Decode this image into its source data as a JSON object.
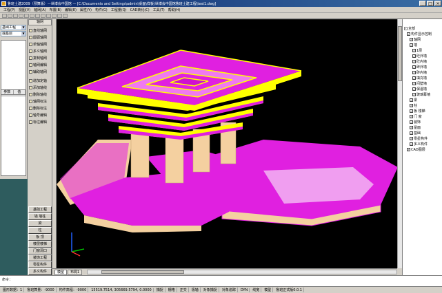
{
  "window": {
    "title": "鲁班土建2009（预算版）—世博会中国馆 — [C:\\Documents and Settings\\admin\\桌面\\样板\\世博会中国馆鲁班土建工程\\test1.dwg]",
    "min": "_",
    "max": "□",
    "close": "×"
  },
  "menu": [
    "工程(P)",
    "视图(V)",
    "轴网(A)",
    "布置(B)",
    "编辑(E)",
    "属性(Y)",
    "构件(G)",
    "工程量(Q)",
    "CAD转化(C)",
    "工具(T)",
    "帮助(H)"
  ],
  "left": {
    "floor_combo": "基础工程",
    "member_combo": "独基层",
    "btn_attr": "属性",
    "btn_change": "更改",
    "grid_cols": [
      "参数",
      "值"
    ]
  },
  "nav": {
    "header": "轴网",
    "items": [
      "直线轴网",
      "圆弧轴网",
      "单轴轴网",
      "多义轴网",
      "复制轴网",
      "轴网编辑",
      "辅助轴网",
      "增加定轴",
      "添加轴线",
      "删除轴线",
      "轴网标注",
      "删除标注",
      "轴号编辑",
      "标注编辑"
    ],
    "categories": [
      "基础工程",
      "墙 墙柱",
      "梁",
      "柱",
      "板 顶",
      "楼层楼梯",
      "门窗洞口",
      "装饰工程",
      "零星构件",
      "多义构件"
    ]
  },
  "tabs": [
    "模型",
    "布局1"
  ],
  "tree": {
    "root": "全部",
    "nodes": [
      {
        "label": "构件显示控制",
        "checked": true,
        "depth": 1
      },
      {
        "label": "轴网",
        "checked": true,
        "depth": 2
      },
      {
        "label": "墙",
        "checked": true,
        "depth": 2
      },
      {
        "label": "1层",
        "checked": true,
        "depth": 3
      },
      {
        "label": "砼外墙",
        "checked": true,
        "depth": 3
      },
      {
        "label": "砼内墙",
        "checked": true,
        "depth": 3
      },
      {
        "label": "砖外墙",
        "checked": true,
        "depth": 3
      },
      {
        "label": "砖内墙",
        "checked": true,
        "depth": 3
      },
      {
        "label": "填充墙",
        "checked": true,
        "depth": 3
      },
      {
        "label": "间壁墙",
        "checked": true,
        "depth": 3
      },
      {
        "label": "保温墙",
        "checked": true,
        "depth": 3
      },
      {
        "label": "玻璃幕墙",
        "checked": true,
        "depth": 3
      },
      {
        "label": "梁",
        "checked": true,
        "depth": 2
      },
      {
        "label": "柱",
        "checked": true,
        "depth": 2
      },
      {
        "label": "板 楼梯",
        "checked": true,
        "depth": 2
      },
      {
        "label": "门 窗",
        "checked": true,
        "depth": 2
      },
      {
        "label": "装饰",
        "checked": true,
        "depth": 2
      },
      {
        "label": "屋面",
        "checked": true,
        "depth": 2
      },
      {
        "label": "基础",
        "checked": true,
        "depth": 2
      },
      {
        "label": "零星构件",
        "checked": true,
        "depth": 2
      },
      {
        "label": "多义构件",
        "checked": true,
        "depth": 2
      },
      {
        "label": "CAD图层",
        "checked": true,
        "depth": 1
      }
    ]
  },
  "command": "命令：",
  "status": [
    "图形数据：1",
    "鲁班算量：-9000",
    "构件高程：-9000",
    "15519.7514, 305669.5794, 0.0000",
    "捕捉",
    "栅格",
    "正交",
    "极轴",
    "对象捕捉",
    "对象追踪",
    "DYN",
    "线宽",
    "模型",
    "鲁班正式版0.0.1"
  ],
  "colors": {
    "roof_yellow": "#ffff00",
    "magenta": "#e020e0",
    "beige": "#f4d0a0",
    "viewport_bg": "#000000",
    "teal": "#2e5c5e"
  }
}
